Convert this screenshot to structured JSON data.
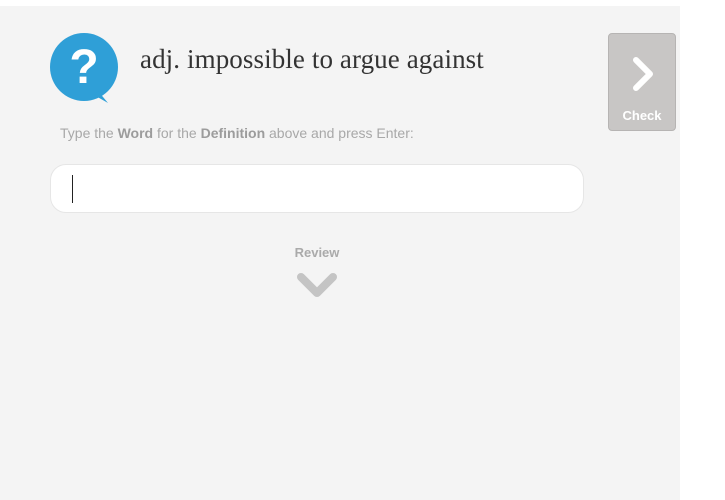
{
  "quiz": {
    "definition": "adj. impossible to argue against",
    "instruction": {
      "part1": "Type the ",
      "word": "Word",
      "part2": " for the ",
      "definition": "Definition",
      "part3": " above and press Enter:"
    },
    "answer_value": "",
    "check_label": "Check",
    "review_label": "Review"
  },
  "icons": {
    "question": "question-bubble-icon",
    "check": "chevron-right-icon",
    "review": "chevron-down-icon"
  },
  "colors": {
    "accent": "#2f9fd7",
    "background": "#f4f4f4",
    "check_button": "#c8c6c5",
    "muted_text": "#a8a8a8"
  }
}
